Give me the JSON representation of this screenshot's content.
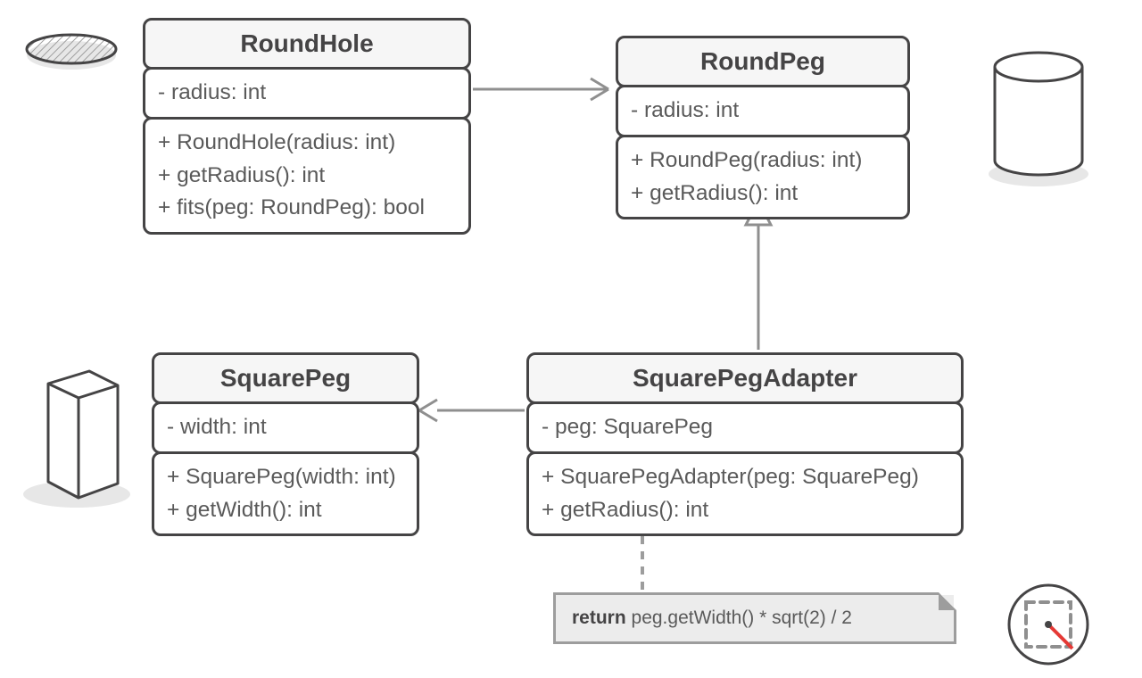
{
  "diagram": {
    "classes": {
      "roundHole": {
        "name": "RoundHole",
        "attributes": [
          "- radius: int"
        ],
        "operations": [
          "+ RoundHole(radius: int)",
          "+ getRadius(): int",
          "+ fits(peg: RoundPeg): bool"
        ]
      },
      "roundPeg": {
        "name": "RoundPeg",
        "attributes": [
          "- radius: int"
        ],
        "operations": [
          "+ RoundPeg(radius: int)",
          "+ getRadius(): int"
        ]
      },
      "squarePeg": {
        "name": "SquarePeg",
        "attributes": [
          "- width: int"
        ],
        "operations": [
          "+ SquarePeg(width: int)",
          "+ getWidth(): int"
        ]
      },
      "squarePegAdapter": {
        "name": "SquarePegAdapter",
        "attributes": [
          "- peg: SquarePeg"
        ],
        "operations": [
          "+ SquarePegAdapter(peg: SquarePeg)",
          "+ getRadius(): int"
        ]
      }
    },
    "note": {
      "keyword": "return",
      "body": " peg.getWidth() * sqrt(2) / 2"
    },
    "relationships": [
      {
        "from": "RoundHole",
        "to": "RoundPeg",
        "type": "dependency"
      },
      {
        "from": "SquarePegAdapter",
        "to": "RoundPeg",
        "type": "inheritance"
      },
      {
        "from": "SquarePegAdapter",
        "to": "SquarePeg",
        "type": "association"
      },
      {
        "from": "SquarePegAdapter",
        "to": "note",
        "type": "note-link"
      }
    ],
    "illustrations": [
      "round-hole",
      "cylinder",
      "cube",
      "square-in-circle"
    ]
  }
}
